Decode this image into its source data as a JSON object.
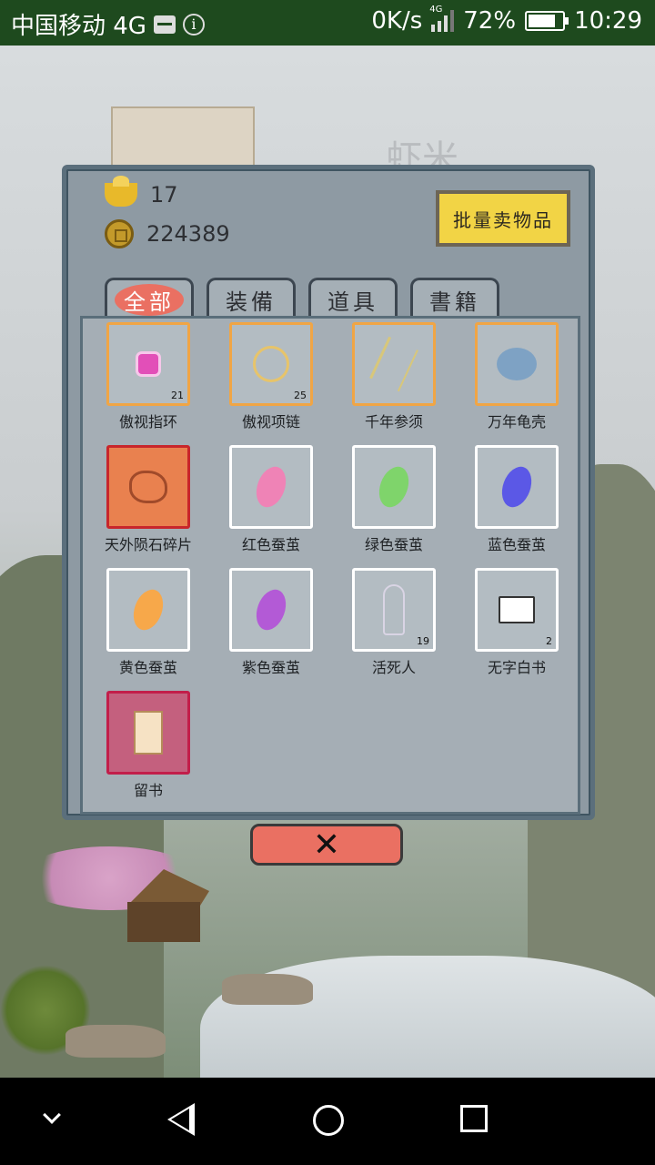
{
  "status_bar": {
    "carrier": "中国移动 4G",
    "network_speed": "0K/s",
    "network_tag": "4G",
    "battery": "72%",
    "time": "10:29"
  },
  "scene": {
    "title": "虾米"
  },
  "dialog": {
    "gold_ingot": "17",
    "copper_coins": "224389",
    "sell_button": "批量卖物品",
    "tabs": [
      {
        "label": "全部",
        "active": true
      },
      {
        "label": "装備",
        "active": false
      },
      {
        "label": "道具",
        "active": false
      },
      {
        "label": "書籍",
        "active": false
      }
    ],
    "items": [
      {
        "name": "傲视指环",
        "count": "21",
        "icon": "ring-icon"
      },
      {
        "name": "傲视项链",
        "count": "25",
        "icon": "necklace-icon"
      },
      {
        "name": "千年参须",
        "count": "",
        "icon": "ginseng-icon"
      },
      {
        "name": "万年龟壳",
        "count": "",
        "icon": "tortoise-shell-icon"
      },
      {
        "name": "天外陨石碎片",
        "count": "",
        "icon": "meteorite-icon"
      },
      {
        "name": "红色蚕茧",
        "count": "",
        "icon": "cocoon-icon"
      },
      {
        "name": "绿色蚕茧",
        "count": "",
        "icon": "cocoon-icon"
      },
      {
        "name": "蓝色蚕茧",
        "count": "",
        "icon": "cocoon-icon"
      },
      {
        "name": "黄色蚕茧",
        "count": "",
        "icon": "cocoon-icon"
      },
      {
        "name": "紫色蚕茧",
        "count": "",
        "icon": "cocoon-icon"
      },
      {
        "name": "活死人",
        "count": "19",
        "icon": "skeleton-icon"
      },
      {
        "name": "无字白书",
        "count": "2",
        "icon": "book-icon"
      },
      {
        "name": "留书",
        "count": "",
        "icon": "letter-icon"
      }
    ],
    "close_button": "✕"
  },
  "colors": {
    "accent_red": "#ea7062",
    "sell_yellow": "#f2d445",
    "rare_orange_border": "#f0a545",
    "cocoon_red": "#ef83b6",
    "cocoon_green": "#7fd46b",
    "cocoon_blue": "#5b58e6",
    "cocoon_yellow": "#f7a84a",
    "cocoon_purple": "#b35ad6"
  }
}
